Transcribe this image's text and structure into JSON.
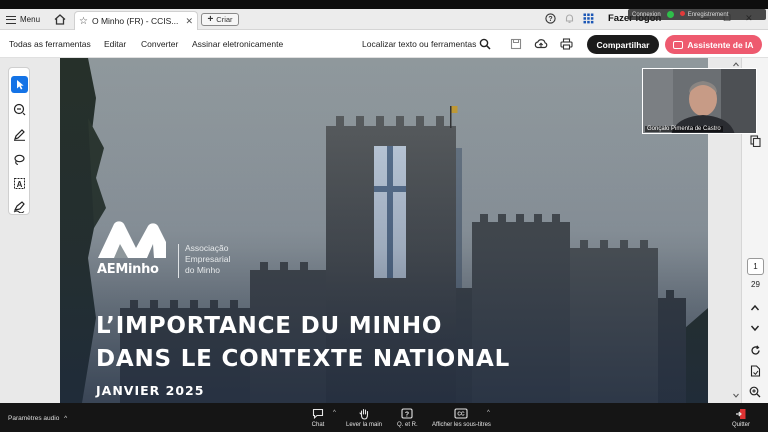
{
  "browser": {
    "menu_label": "Menu",
    "tab_title": "O Minho (FR) - CCIS...",
    "new_tab_label": "Criar",
    "signin_label": "Fazer logon"
  },
  "recording": {
    "connection_label": "Connexion",
    "recording_label": "Enregistrement"
  },
  "toolbar": {
    "all_tools": "Todas as ferramentas",
    "edit": "Editar",
    "convert": "Converter",
    "sign": "Assinar eletronicamente",
    "find": "Localizar texto ou ferramentas",
    "share": "Compartilhar",
    "ai_assistant": "Assistente de IA"
  },
  "slide": {
    "logo_name": "AEMinho",
    "assoc_line1": "Associação",
    "assoc_line2": "Empresarial",
    "assoc_line3": "do Minho",
    "headline_line1": "L’IMPORTANCE DU MINHO",
    "headline_line2": "DANS LE CONTEXTE NATIONAL",
    "date": "JANVIER 2025"
  },
  "webcam": {
    "participant_name": "Gonçalo Pimenta de Castro"
  },
  "pager": {
    "current_page": "1",
    "total_pages": "29"
  },
  "meeting": {
    "audio_settings": "Paramètres audio",
    "chat": "Chat",
    "raise_hand": "Lever la main",
    "qa": "Q. et R.",
    "captions": "Afficher les sous-titres",
    "quit": "Quitter"
  },
  "colors": {
    "share_button": "#1b1b1b",
    "ai_button": "#ee5a6f",
    "active_tool": "#1473e6",
    "meeting_bar": "#151515"
  }
}
